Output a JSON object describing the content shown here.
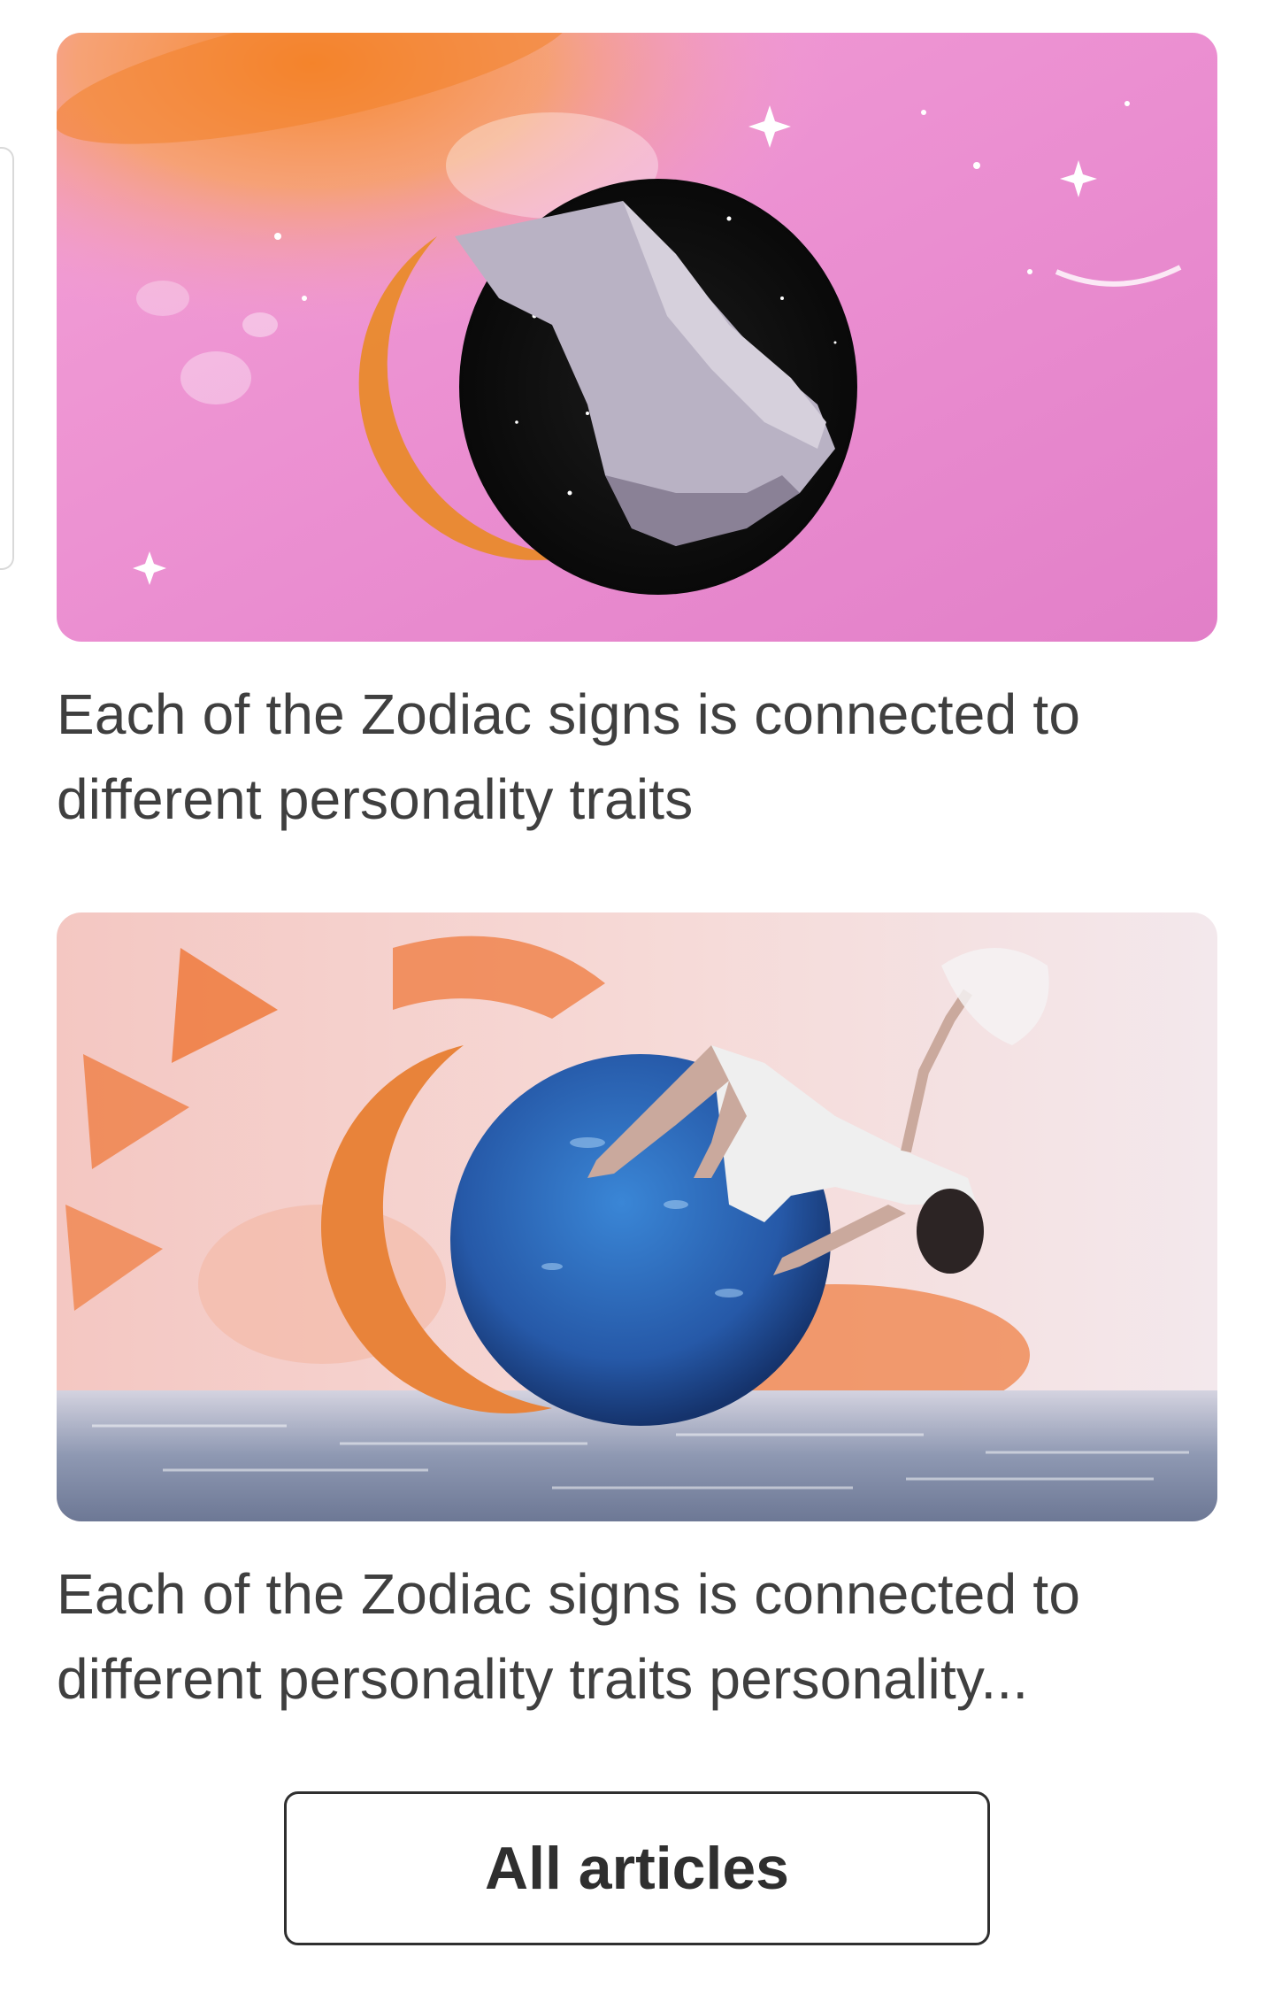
{
  "articles": [
    {
      "title": "Each of the Zodiac signs is connected to different personality traits",
      "image": {
        "icon": "holding-hands-moon-collage",
        "accent": "#ea8fd0",
        "secondary": "#f28a3a"
      }
    },
    {
      "title": "Each of the Zodiac signs is connected to different personality traits personality...",
      "image": {
        "icon": "floating-woman-planet-collage",
        "accent": "#2a68c0",
        "secondary": "#ef7a3c"
      }
    }
  ],
  "footer": {
    "all_articles_label": "All articles"
  }
}
